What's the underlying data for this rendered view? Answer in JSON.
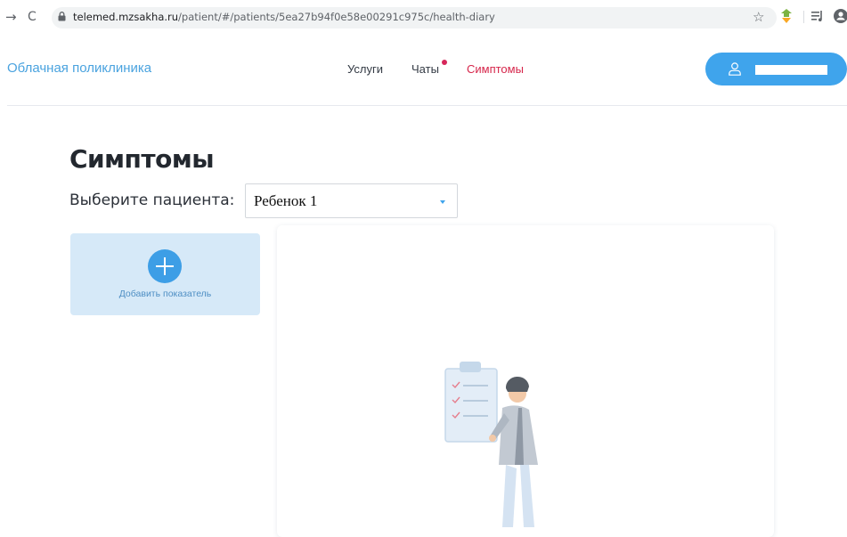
{
  "browser": {
    "url_host": "telemed.mzsakha.ru",
    "url_path": "/patient/#/patients/5ea27b94f0e58e00291c975c/health-diary",
    "back_icon": "arrow-right-icon",
    "reload_icon": "reload-icon",
    "star_glyph": "☆"
  },
  "header": {
    "brand": "Облачная поликлиника",
    "nav": {
      "services": "Услуги",
      "chats": "Чаты",
      "symptoms": "Симптомы"
    },
    "chats_has_notification": true,
    "accent_color": "#3fa4ec",
    "active_nav_color": "#d6264b"
  },
  "main": {
    "title": "Симптомы",
    "patient_label": "Выберите пациента:",
    "patient_selected": "Ребенок 1",
    "add_indicator_label": "Добавить показатель"
  }
}
